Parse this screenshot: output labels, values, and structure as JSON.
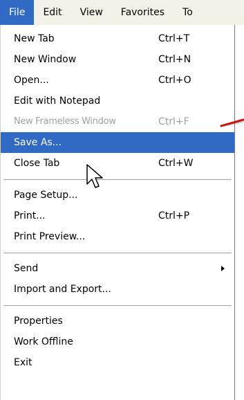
{
  "menubar": {
    "items": [
      {
        "label": "File"
      },
      {
        "label": "Edit"
      },
      {
        "label": "View"
      },
      {
        "label": "Favorites"
      },
      {
        "label": "To"
      }
    ]
  },
  "file_menu": {
    "items": [
      {
        "label": "New Tab",
        "shortcut": "Ctrl+T"
      },
      {
        "label": "New Window",
        "shortcut": "Ctrl+N"
      },
      {
        "label": "Open...",
        "shortcut": "Ctrl+O"
      },
      {
        "label": "Edit with Notepad",
        "shortcut": ""
      },
      {
        "label": "New Frameless Window",
        "shortcut": "Ctrl+F",
        "disabled": true
      },
      {
        "label": "Save As...",
        "shortcut": "",
        "highlighted": true
      },
      {
        "label": "Close Tab",
        "shortcut": "Ctrl+W"
      },
      {
        "label": "Page Setup...",
        "shortcut": ""
      },
      {
        "label": "Print...",
        "shortcut": "Ctrl+P"
      },
      {
        "label": "Print Preview...",
        "shortcut": ""
      },
      {
        "label": "Send",
        "shortcut": "",
        "submenu": true
      },
      {
        "label": "Import and Export...",
        "shortcut": ""
      },
      {
        "label": "Properties",
        "shortcut": ""
      },
      {
        "label": "Work Offline",
        "shortcut": ""
      },
      {
        "label": "Exit",
        "shortcut": ""
      }
    ]
  },
  "colors": {
    "highlight": "#316ac5",
    "disabled_text": "#a0a0a0",
    "annotation_arrow": "#cc1111"
  },
  "icons": {
    "cursor": "arrow-cursor-icon",
    "annotation": "red-arrow-icon",
    "submenu": "submenu-arrow-icon"
  }
}
